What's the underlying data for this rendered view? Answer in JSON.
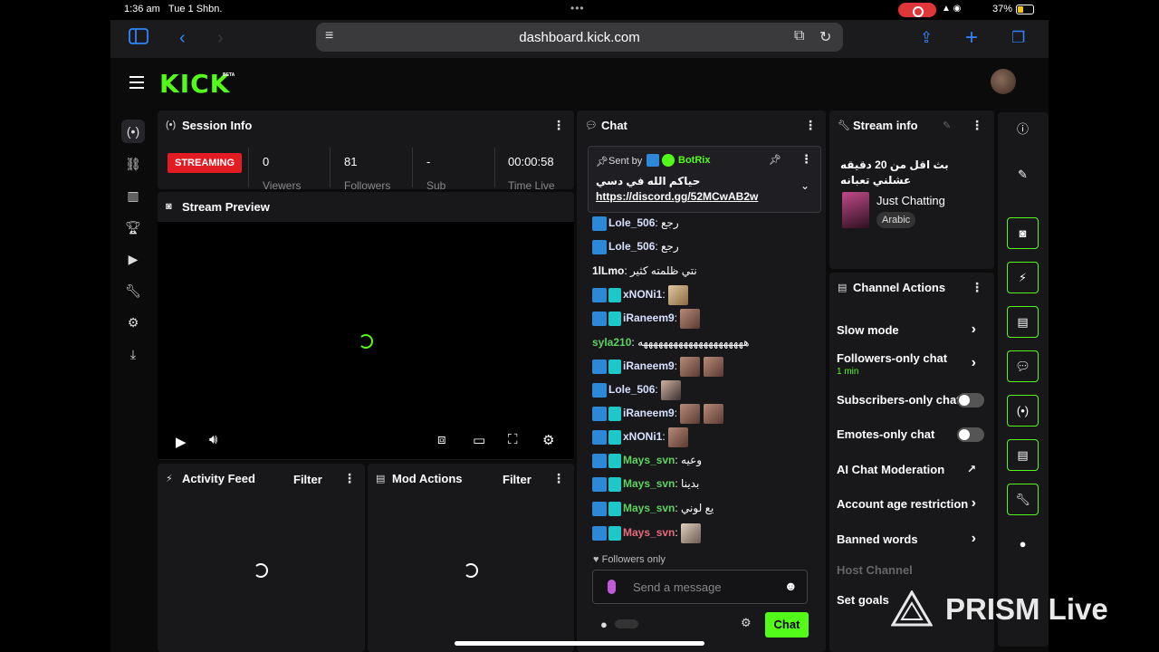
{
  "status_bar": {
    "time": "1:36 am",
    "date": "Tue 1 Shbn.",
    "battery": "37%"
  },
  "browser": {
    "url": "dashboard.kick.com"
  },
  "header": {
    "logo": "KICK",
    "beta": "BETA"
  },
  "session_info": {
    "title": "Session Info",
    "status": "STREAMING",
    "stats": [
      {
        "value": "0",
        "label": "Viewers"
      },
      {
        "value": "81",
        "label": "Followers"
      },
      {
        "value": "-",
        "label": "Sub"
      },
      {
        "value": "00:00:58",
        "label": "Time Live"
      }
    ]
  },
  "stream_preview": {
    "title": "Stream Preview"
  },
  "activity_feed": {
    "title": "Activity Feed",
    "filter": "Filter"
  },
  "mod_actions": {
    "title": "Mod Actions",
    "filter": "Filter"
  },
  "chat": {
    "title": "Chat",
    "pinned": {
      "sent_by": "Sent by",
      "author": "BotRix",
      "text": "حياكم الله في دسي",
      "link": "https://discord.gg/52MCwAB2w"
    },
    "messages": [
      {
        "user": "Lole_506",
        "text": "رجع",
        "color": "#d8e0ff"
      },
      {
        "user": "Lole_506",
        "text": "رجع",
        "color": "#d8e0ff"
      },
      {
        "user": "1lLmo",
        "text": "نتي ظلمته كثير",
        "color": "#ffffff"
      },
      {
        "user": "xNONi1",
        "text": "",
        "color": "#d8e0ff"
      },
      {
        "user": "iRaneem9",
        "text": "",
        "color": "#d8e0ff"
      },
      {
        "user": "syla210",
        "text": "هههههههههههههههههههههه",
        "color": "#5fd35f"
      },
      {
        "user": "iRaneem9",
        "text": "",
        "color": "#d8e0ff"
      },
      {
        "user": "Lole_506",
        "text": "",
        "color": "#d8e0ff"
      },
      {
        "user": "iRaneem9",
        "text": "",
        "color": "#d8e0ff"
      },
      {
        "user": "xNONi1",
        "text": "",
        "color": "#d8e0ff"
      },
      {
        "user": "Mays_svn",
        "text": "وعيه",
        "color": "#5fd35f"
      },
      {
        "user": "Mays_svn",
        "text": "بدينا",
        "color": "#5fd35f"
      },
      {
        "user": "Mays_svn",
        "text": "يع لوني",
        "color": "#5fd35f"
      },
      {
        "user": "Mays_svn",
        "text": "",
        "color": "#e86a7a"
      }
    ],
    "followers_only": "Followers only",
    "input_placeholder": "Send a message",
    "send_label": "Chat"
  },
  "stream_info": {
    "title": "Stream info",
    "stream_title": "بث اقل من 20 دقيقه عشلني تعبانه",
    "category": "Just Chatting",
    "language": "Arabic"
  },
  "channel_actions": {
    "title": "Channel Actions",
    "items": [
      {
        "label": "Slow mode"
      },
      {
        "label": "Followers-only chat",
        "sub": "1 min"
      },
      {
        "label": "Subscribers-only chat"
      },
      {
        "label": "Emotes-only chat"
      },
      {
        "label": "AI Chat Moderation"
      },
      {
        "label": "Account age restriction"
      },
      {
        "label": "Banned words"
      },
      {
        "label": "Host Channel"
      },
      {
        "label": "Set goals"
      }
    ]
  },
  "watermark": {
    "text": "PRISM Live"
  }
}
